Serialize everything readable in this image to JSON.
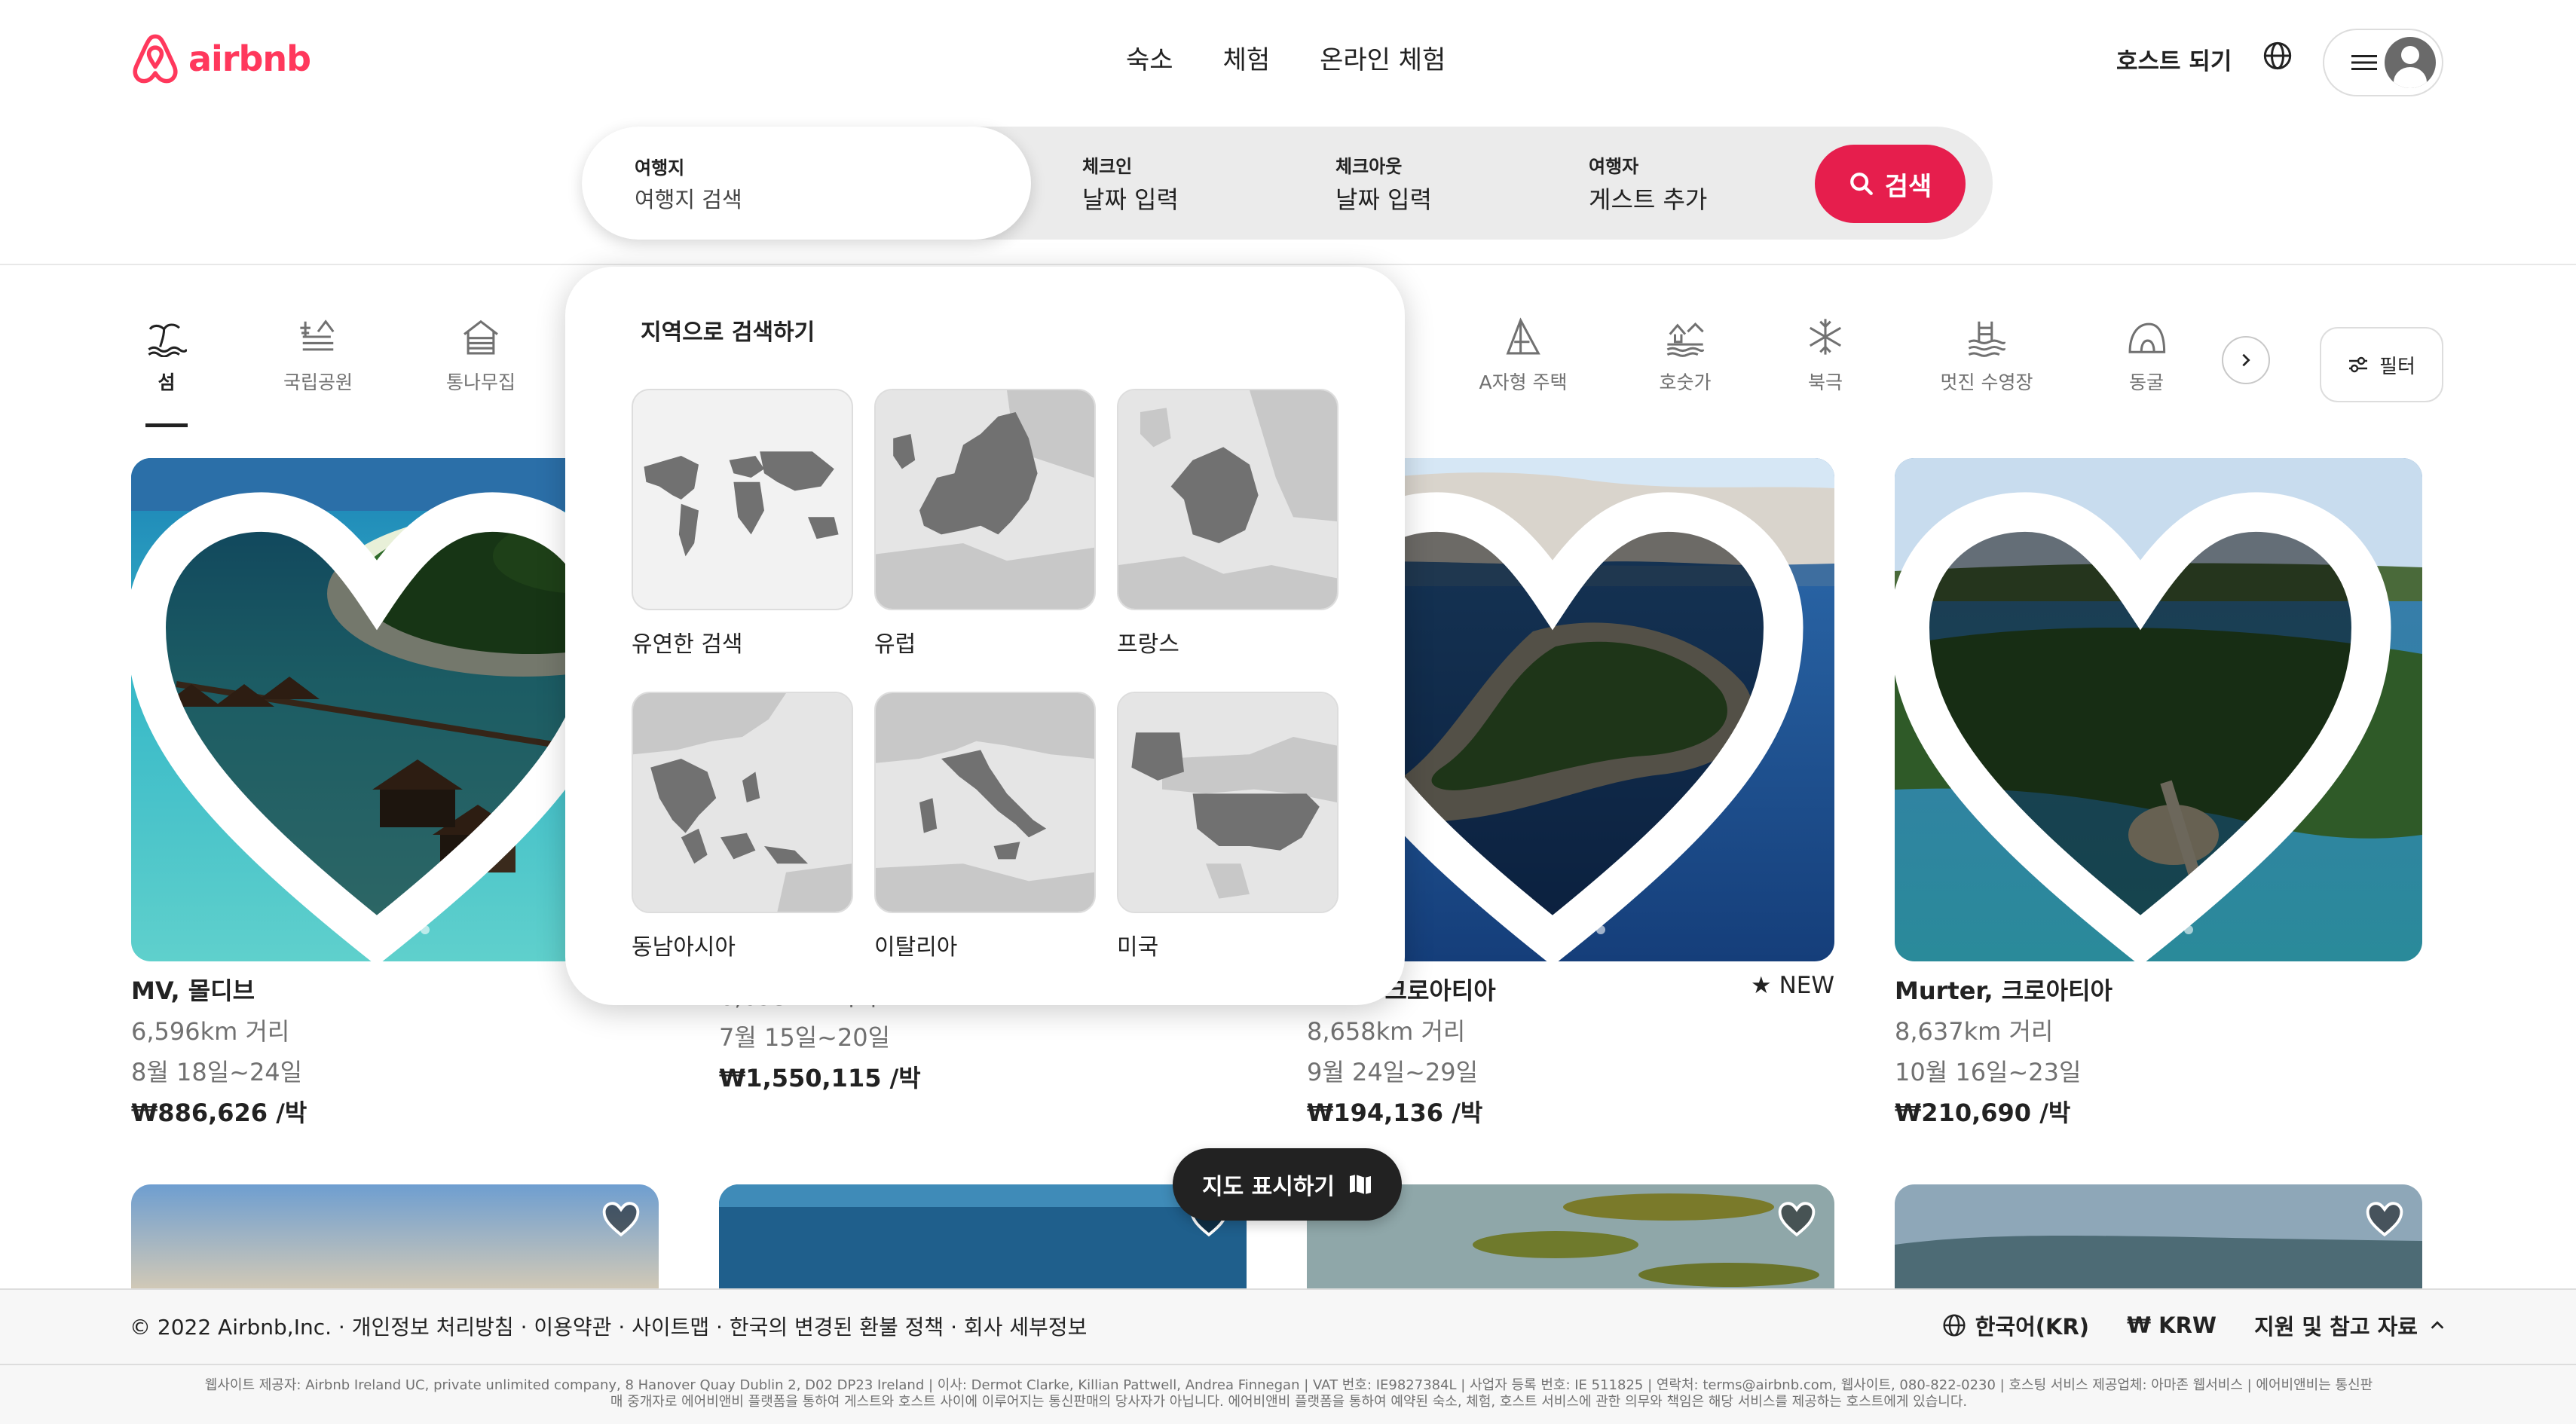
{
  "brand": {
    "name": "airbnb",
    "color": "#ff385c"
  },
  "top_nav": [
    "숙소",
    "체험",
    "온라인 체험"
  ],
  "header_right": {
    "host_label": "호스트 되기",
    "globe_icon": "globe-icon",
    "menu_icon": "menu-icon"
  },
  "search": {
    "destination": {
      "label": "여행지",
      "placeholder": "여행지 검색"
    },
    "check_in": {
      "label": "체크인",
      "value": "날짜 입력"
    },
    "check_out": {
      "label": "체크아웃",
      "value": "날짜 입력"
    },
    "guests": {
      "label": "여행자",
      "value": "게스트 추가"
    },
    "button_label": "검색",
    "accent": "#e61e4d"
  },
  "categories": [
    {
      "label": "섬",
      "icon": "island-icon",
      "active": true
    },
    {
      "label": "국립공원",
      "icon": "national-park-icon",
      "active": false
    },
    {
      "label": "통나무집",
      "icon": "cabin-icon",
      "active": false
    },
    {
      "label": "A자형 주택",
      "icon": "a-frame-icon",
      "active": false
    },
    {
      "label": "호숫가",
      "icon": "lakeside-icon",
      "active": false
    },
    {
      "label": "북극",
      "icon": "snowflake-icon",
      "active": false
    },
    {
      "label": "멋진 수영장",
      "icon": "pool-icon",
      "active": false
    },
    {
      "label": "동굴",
      "icon": "cave-icon",
      "active": false
    }
  ],
  "filter_label": "필터",
  "region_search": {
    "title": "지역으로 검색하기",
    "regions": [
      {
        "name": "유연한 검색",
        "map": "world-map"
      },
      {
        "name": "유럽",
        "map": "europe-map"
      },
      {
        "name": "프랑스",
        "map": "france-map"
      },
      {
        "name": "동남아시아",
        "map": "southeast-asia-map"
      },
      {
        "name": "이탈리아",
        "map": "italy-map"
      },
      {
        "name": "미국",
        "map": "usa-map"
      }
    ]
  },
  "listings": [
    {
      "title": "MV, 몰디브",
      "distance": "6,596km 거리",
      "dates": "8월 18일~24일",
      "price": "₩886,626 /박",
      "rating": ""
    },
    {
      "title": "",
      "distance": "6,693km 거리",
      "dates": "7월 15일~20일",
      "price": "₩1,550,115 /박",
      "rating": ""
    },
    {
      "title": "Žaboric, Croatia 크로아티아",
      "title_visible": "batia 크로아티아",
      "distance": "8,658km 거리",
      "dates": "9월 24일~29일",
      "price": "₩194,136 /박",
      "rating": "NEW"
    },
    {
      "title": "Murter, 크로아티아",
      "distance": "8,637km 거리",
      "dates": "10월 16일~23일",
      "price": "₩210,690 /박",
      "rating": ""
    }
  ],
  "map_button_label": "지도 표시하기",
  "footer": {
    "left": "© 2022 Airbnb,Inc. · 개인정보 처리방침 · 이용약관 · 사이트맵 · 한국의 변경된 환불 정책 · 회사 세부정보",
    "language": "한국어(KR)",
    "currency": "₩ KRW",
    "support": "지원 및 참고 자료",
    "legal_1": "웹사이트 제공자: Airbnb Ireland UC, private unlimited company, 8 Hanover Quay Dublin 2, D02 DP23 Ireland | 이사: Dermot Clarke, Killian Pattwell, Andrea Finnegan | VAT 번호: IE9827384L | 사업자 등록 번호: IE 511825 | 연락처: terms@airbnb.com, 웹사이트, 080-822-0230 | 호스팅 서비스 제공업체: 아마존 웹서비스 | 에어비앤비는 통신판",
    "legal_2": "매 중개자로 에어비앤비 플랫폼을 통하여 게스트와 호스트 사이에 이루어지는 통신판매의 당사자가 아닙니다. 에어비앤비 플랫폼을 통하여 예약된 숙소, 체험, 호스트 서비스에 관한 의무와 책임은 해당 서비스를 제공하는 호스트에게 있습니다."
  }
}
